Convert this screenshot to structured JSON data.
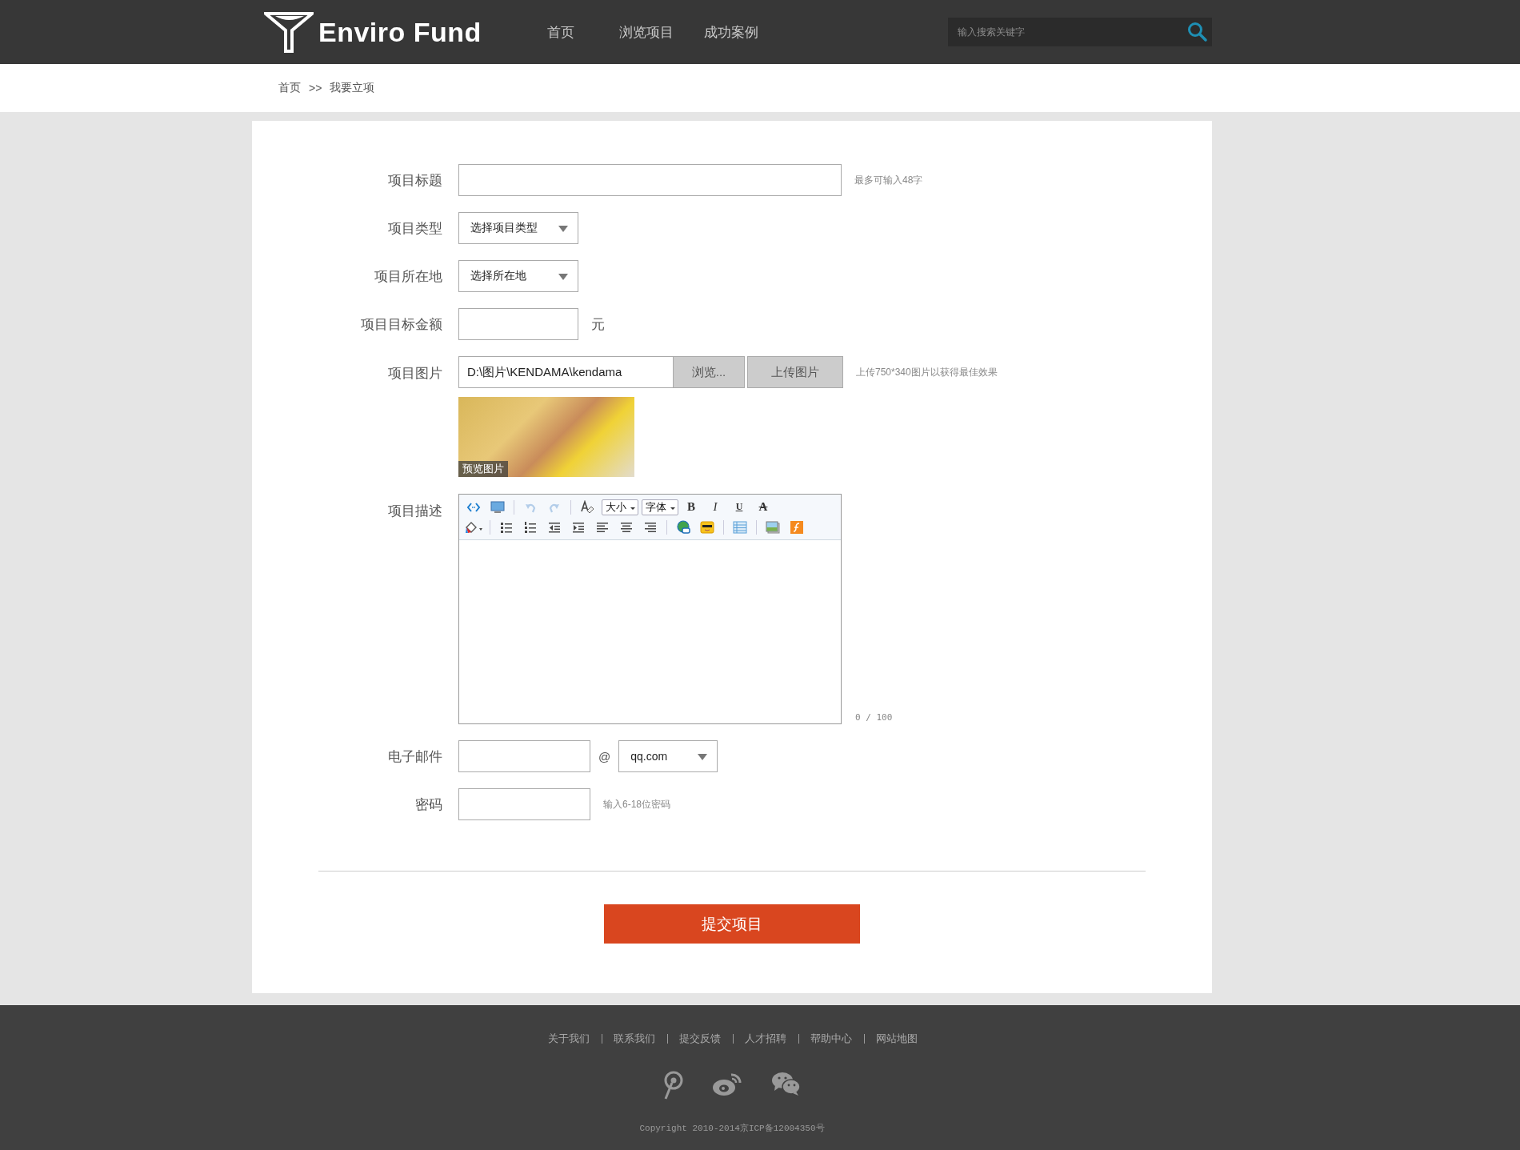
{
  "header": {
    "logo": "Enviro Fund",
    "nav": [
      {
        "label": "首页"
      },
      {
        "label": "浏览项目"
      },
      {
        "label": "成功案例"
      }
    ],
    "search": {
      "placeholder": "输入搜索关键字"
    }
  },
  "breadcrumb": {
    "home": "首页",
    "separator": ">>",
    "current": "我要立项"
  },
  "form": {
    "title": {
      "label": "项目标题",
      "hint": "最多可输入48字"
    },
    "type": {
      "label": "项目类型",
      "value": "选择项目类型"
    },
    "location": {
      "label": "项目所在地",
      "value": "选择所在地"
    },
    "amount": {
      "label": "项目目标金额",
      "unit": "元"
    },
    "image": {
      "label": "项目图片",
      "value": "D:\\图片\\KENDAMA\\kendama",
      "browse": "浏览...",
      "upload": "上传图片",
      "hint": "上传750*340图片以获得最佳效果",
      "preview_caption": "预览图片"
    },
    "description": {
      "label": "项目描述",
      "counter": "0 / 100",
      "toolbar": [
        [
          {
            "kind": "source"
          },
          {
            "kind": "preview"
          },
          {
            "kind": "separator"
          },
          {
            "kind": "undo",
            "disabled": true
          },
          {
            "kind": "redo",
            "disabled": true
          },
          {
            "kind": "separator"
          },
          {
            "kind": "eraser"
          },
          {
            "kind": "dropdown",
            "text": "大小"
          },
          {
            "kind": "dropdown",
            "text": "字体"
          },
          {
            "kind": "bold",
            "text": "B"
          },
          {
            "kind": "italic",
            "text": "I"
          },
          {
            "kind": "underline",
            "text": "U"
          },
          {
            "kind": "strike",
            "text": "A"
          }
        ],
        [
          {
            "kind": "fill"
          },
          {
            "kind": "separator"
          },
          {
            "kind": "bullets"
          },
          {
            "kind": "numbers"
          },
          {
            "kind": "outdent"
          },
          {
            "kind": "indent"
          },
          {
            "kind": "left"
          },
          {
            "kind": "center"
          },
          {
            "kind": "right"
          },
          {
            "kind": "separator"
          },
          {
            "kind": "link"
          },
          {
            "kind": "emoticon"
          },
          {
            "kind": "separator"
          },
          {
            "kind": "table"
          },
          {
            "kind": "separator"
          },
          {
            "kind": "image"
          },
          {
            "kind": "flash"
          }
        ]
      ]
    },
    "email": {
      "label": "电子邮件",
      "at": "@",
      "domain": "qq.com"
    },
    "password": {
      "label": "密码",
      "hint": "输入6-18位密码"
    },
    "submit": "提交项目"
  },
  "footer": {
    "links": [
      "关于我们",
      "联系我们",
      "提交反馈",
      "人才招聘",
      "帮助中心",
      "网站地图"
    ],
    "copyright": "Copyright 2010-2014京ICP备12004350号"
  }
}
